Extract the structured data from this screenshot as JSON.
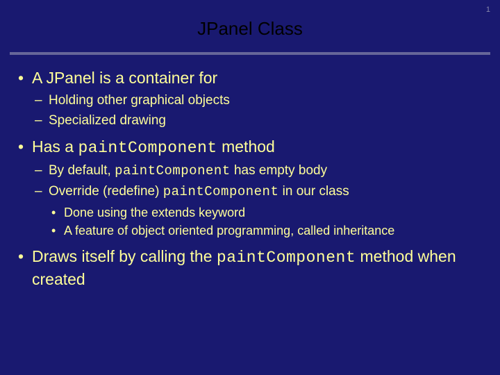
{
  "page_number": "1",
  "title": "JPanel Class",
  "b1": "A JPanel is a container for",
  "b1s1": "Holding other graphical objects",
  "b1s2": "Specialized drawing",
  "b2a": "Has a ",
  "b2code": "paintComponent",
  "b2b": " method",
  "b2s1a": "By default, ",
  "b2s1code": "paintComponent",
  "b2s1b": " has empty body",
  "b2s2a": "Override (redefine) ",
  "b2s2code": "paintComponent",
  "b2s2b": " in our class",
  "b2s2t1": "Done using the extends keyword",
  "b2s2t2": "A feature of object oriented programming, called inheritance",
  "b3a": "Draws itself by calling the ",
  "b3code": "paintComponent",
  "b3b": " method when created"
}
